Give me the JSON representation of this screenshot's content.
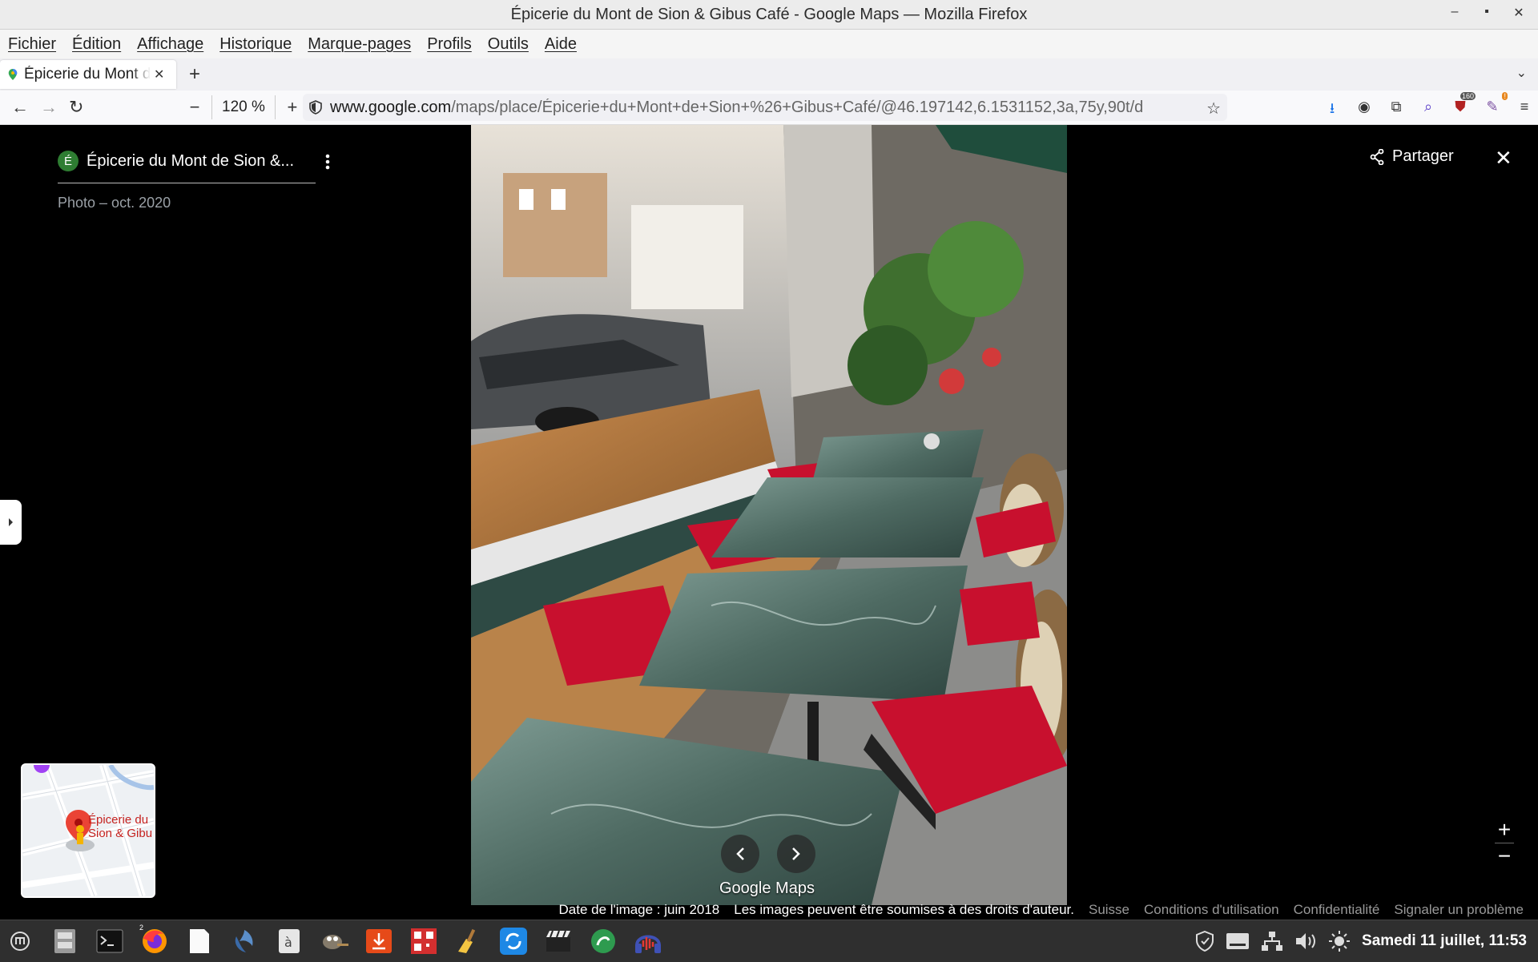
{
  "window": {
    "title": "Épicerie du Mont de Sion & Gibus Café - Google Maps — Mozilla Firefox",
    "controls": [
      "–",
      "▪",
      "✕"
    ]
  },
  "menubar": {
    "items": [
      "Fichier",
      "Édition",
      "Affichage",
      "Historique",
      "Marque-pages",
      "Profils",
      "Outils",
      "Aide"
    ]
  },
  "tabs": [
    {
      "title": "Épicerie du Mont de Sion",
      "active": true
    }
  ],
  "navbar": {
    "zoom": "120 %",
    "url_host": "www.google.com",
    "url_path": "/maps/place/Épicerie+du+Mont+de+Sion+%26+Gibus+Café/@46.197142,6.1531152,3a,75y,90t/d",
    "badge_count": "160",
    "badge_alert": "!"
  },
  "place": {
    "letter": "É",
    "name": "Épicerie du Mont de Sion &...",
    "photo_date": "Photo – oct. 2020"
  },
  "viewer": {
    "share_label": "Partager",
    "close_label": "✕",
    "logo": "Google Maps",
    "zoom_in": "+",
    "zoom_out": "−"
  },
  "minimap": {
    "label_line1": "Épicerie du",
    "label_line2": "Sion & Gibu"
  },
  "footer": {
    "image_date": "Date de l'image : juin 2018",
    "rights": "Les images peuvent être soumises à des droits d'auteur.",
    "country": "Suisse",
    "terms": "Conditions d'utilisation",
    "privacy": "Confidentialité",
    "report": "Signaler un problème"
  },
  "taskbar": {
    "clock": "Samedi 11 juillet, 11:53",
    "firefox_count": "2"
  },
  "colors": {
    "accent_green": "#2e7d32",
    "pin_red": "#ea4335",
    "table_marble": "#5b7a72",
    "cushion_red": "#c8102e"
  }
}
